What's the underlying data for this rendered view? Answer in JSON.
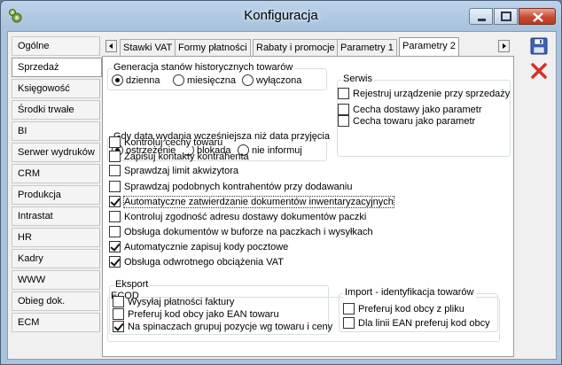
{
  "window": {
    "title": "Konfiguracja"
  },
  "sidebar": {
    "items": [
      {
        "label": "Ogólne"
      },
      {
        "label": "Sprzedaż"
      },
      {
        "label": "Księgowość"
      },
      {
        "label": "Środki trwałe"
      },
      {
        "label": "BI"
      },
      {
        "label": "Serwer wydruków"
      },
      {
        "label": "CRM"
      },
      {
        "label": "Produkcja"
      },
      {
        "label": "Intrastat"
      },
      {
        "label": "HR"
      },
      {
        "label": "Kadry"
      },
      {
        "label": "WWW"
      },
      {
        "label": "Obieg dok."
      },
      {
        "label": "ECM"
      }
    ],
    "active_index": 1
  },
  "tabs": {
    "items": [
      {
        "label": "Stawki VAT"
      },
      {
        "label": "Formy płatności"
      },
      {
        "label": "Rabaty i promocje"
      },
      {
        "label": "Parametry 1"
      },
      {
        "label": "Parametry 2"
      }
    ],
    "active_index": 4
  },
  "gen": {
    "title": "Generacja stanów historycznych towarów",
    "options": [
      "dzienna",
      "miesięczna",
      "wyłączona"
    ],
    "selected": 0
  },
  "date": {
    "title": "Gdy data wydania wcześniejsza niż data przyjęcia",
    "options": [
      "ostrzeżenie",
      "blokada",
      "nie informuj"
    ],
    "selected": 0
  },
  "serwis": {
    "title": "Serwis",
    "items": [
      {
        "label": "Rejestruj urządzenie przy sprzedaży",
        "checked": false
      },
      {
        "label": "Cecha dostawy jako parametr",
        "checked": false
      },
      {
        "label": "Cecha towaru jako parametr",
        "checked": false
      }
    ]
  },
  "options": [
    {
      "label": "Kontroluj cechy towaru",
      "checked": false
    },
    {
      "label": "Zapisuj kontakty kontrahenta",
      "checked": false
    },
    {
      "label": "Sprawdzaj limit akwizytora",
      "checked": false
    },
    {
      "label": "Sprawdzaj podobnych kontrahentów przy dodawaniu",
      "checked": false
    },
    {
      "label": "Automatyczne zatwierdzanie dokumentów inwentaryzacyjnych",
      "checked": true
    },
    {
      "label": "Kontroluj zgodność adresu dostawy dokumentów paczki",
      "checked": false
    },
    {
      "label": "Obsługa dokumentów w buforze na paczkach i wysyłkach",
      "checked": false
    },
    {
      "label": "Automatycznie zapisuj kody pocztowe",
      "checked": true
    },
    {
      "label": "Obsługa odwrotnego obciążenia VAT",
      "checked": true
    }
  ],
  "ecod": {
    "title": "ECOD",
    "eksport": {
      "title": "Eksport",
      "items": [
        {
          "label": "Wysyłaj płatności faktury",
          "checked": false
        },
        {
          "label": "Preferuj kod obcy jako EAN towaru",
          "checked": false
        },
        {
          "label": "Na spinaczach grupuj pozycje wg towaru i ceny",
          "checked": true
        }
      ]
    },
    "import": {
      "title": "Import - identyfikacja towarów",
      "items": [
        {
          "label": "Preferuj kod obcy z pliku",
          "checked": false
        },
        {
          "label": "Dla linii EAN preferuj kod obcy",
          "checked": false
        }
      ]
    }
  }
}
